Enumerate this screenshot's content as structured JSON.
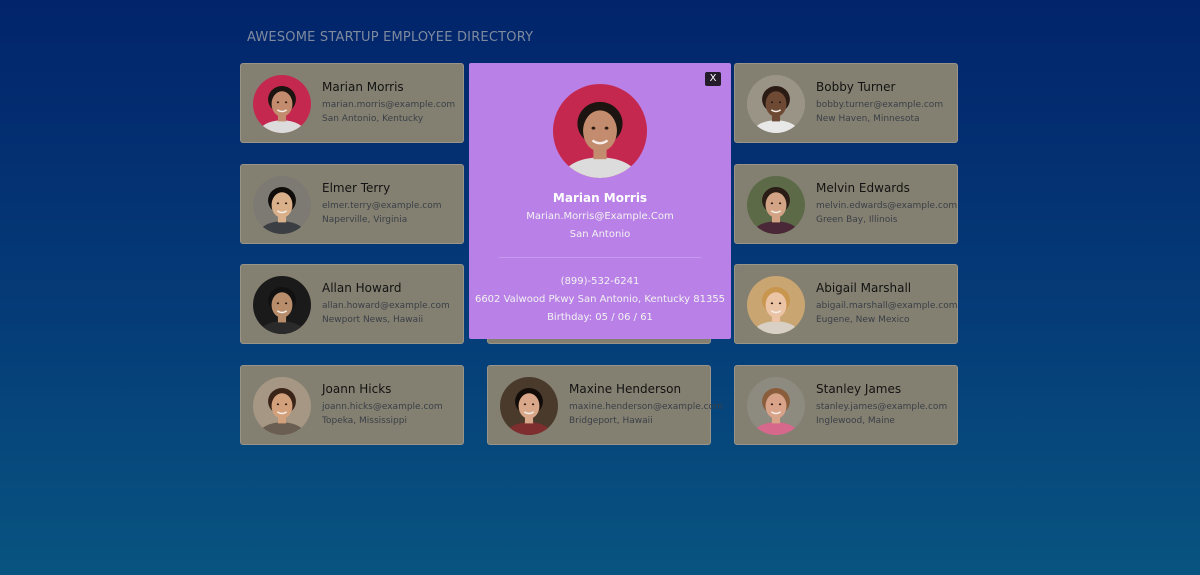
{
  "page": {
    "title": "AWESOME STARTUP EMPLOYEE DIRECTORY"
  },
  "colors": {
    "background_top": "#02246b",
    "background_bottom": "#085480",
    "card": "#848071",
    "modal": "#b981e7",
    "close_button": "#241b2a"
  },
  "employees": [
    {
      "name": "Marian Morris",
      "email": "marian.morris@example.com",
      "location": "San Antonio, Kentucky",
      "avatar_bg": "#c4284f",
      "skin": "#c48c6e",
      "hair": "#1c1410",
      "shirt": "#dcdcdc"
    },
    {
      "name": "Elmer Terry",
      "email": "elmer.terry@example.com",
      "location": "Naperville, Virginia",
      "avatar_bg": "#7c7a72",
      "skin": "#d9b08a",
      "hair": "#0f0c0a",
      "shirt": "#3b3e43"
    },
    {
      "name": "Allan Howard",
      "email": "allan.howard@example.com",
      "location": "Newport News, Hawaii",
      "avatar_bg": "#1a1a1a",
      "skin": "#b88d6b",
      "hair": "#111111",
      "shirt": "#2a2a2a"
    },
    {
      "name": "Joann Hicks",
      "email": "joann.hicks@example.com",
      "location": "Topeka, Mississippi",
      "avatar_bg": "#a69684",
      "skin": "#d3a07c",
      "hair": "#3a2418",
      "shirt": "#6a5e52"
    },
    {
      "name": "Maxine Henderson",
      "email": "maxine.henderson@example.com",
      "location": "Bridgeport, Hawaii",
      "avatar_bg": "#4a3a2c",
      "skin": "#d9a88a",
      "hair": "#120c08",
      "shirt": "#7e2e2e"
    },
    {
      "name": "Bobby Turner",
      "email": "bobby.turner@example.com",
      "location": "New Haven, Minnesota",
      "avatar_bg": "#9a9486",
      "skin": "#6e4a35",
      "hair": "#2a1c14",
      "shirt": "#e8e8e8"
    },
    {
      "name": "Melvin Edwards",
      "email": "melvin.edwards@example.com",
      "location": "Green Bay, Illinois",
      "avatar_bg": "#5c6a48",
      "skin": "#d2a485",
      "hair": "#2a1d15",
      "shirt": "#4a2838"
    },
    {
      "name": "Abigail Marshall",
      "email": "abigail.marshall@example.com",
      "location": "Eugene, New Mexico",
      "avatar_bg": "#c9a572",
      "skin": "#ebc4a5",
      "hair": "#c9964f",
      "shirt": "#d8d0c4"
    },
    {
      "name": "Stanley James",
      "email": "stanley.james@example.com",
      "location": "Inglewood, Maine",
      "avatar_bg": "#8d8a80",
      "skin": "#d8a388",
      "hair": "#8a5e3c",
      "shirt": "#d6688c"
    }
  ],
  "modal": {
    "close_label": "X",
    "name": "Marian Morris",
    "email": "Marian.Morris@Example.Com",
    "city": "San Antonio",
    "phone": "(899)-532-6241",
    "address": "6602 Valwood Pkwy San Antonio, Kentucky 81355",
    "birthday": "Birthday: 05 / 06 / 61"
  }
}
